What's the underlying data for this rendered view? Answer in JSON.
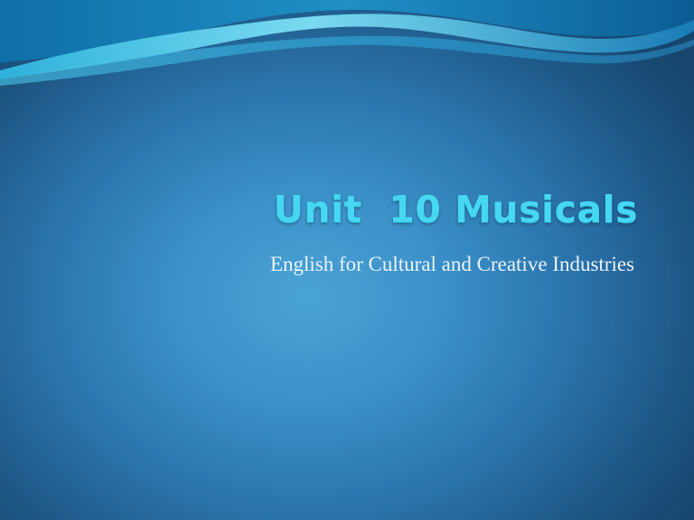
{
  "slide": {
    "title": "Unit  10 Musicals",
    "subtitle": "English for Cultural and Creative Industries"
  },
  "colors": {
    "title": "#46d7f2",
    "subtitle": "#e9f4fb",
    "background_center": "#4aa3d6",
    "background_edge": "#16466d",
    "wave_light": "#7fe0f5",
    "wave_dark": "#0f6fa6"
  }
}
